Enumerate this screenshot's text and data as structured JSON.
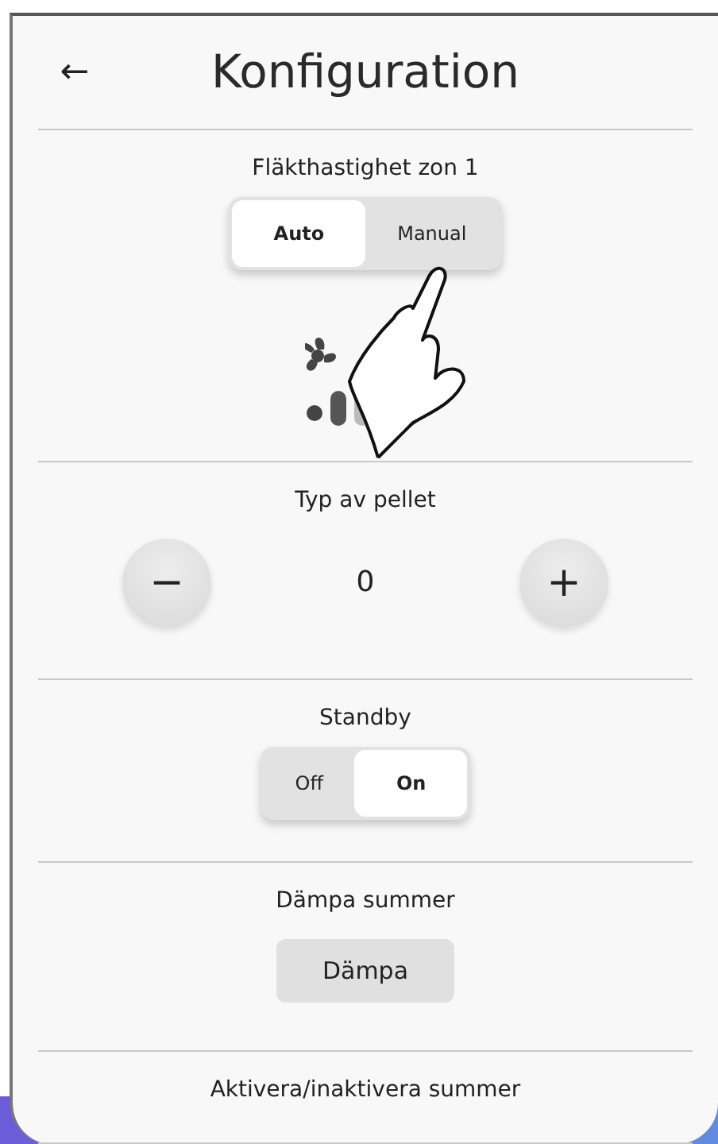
{
  "header": {
    "back": "←",
    "title": "Konfiguration"
  },
  "sections": [
    {
      "kind": "fan_mode",
      "title": "Fläkthastighet zon 1",
      "options": [
        {
          "label": "Auto",
          "selected": true
        },
        {
          "label": "Manual",
          "selected": false
        }
      ]
    },
    {
      "kind": "stepper",
      "title": "Typ av pellet",
      "minus": "−",
      "value": "0",
      "plus": "+"
    },
    {
      "kind": "segmented",
      "title": "Standby",
      "options": [
        {
          "label": "Off",
          "selected": false
        },
        {
          "label": "On",
          "selected": true
        }
      ]
    },
    {
      "kind": "button",
      "title": "Dämpa summer",
      "button": "Dämpa"
    },
    {
      "kind": "heading",
      "title": "Aktivera/inaktivera summer"
    }
  ]
}
